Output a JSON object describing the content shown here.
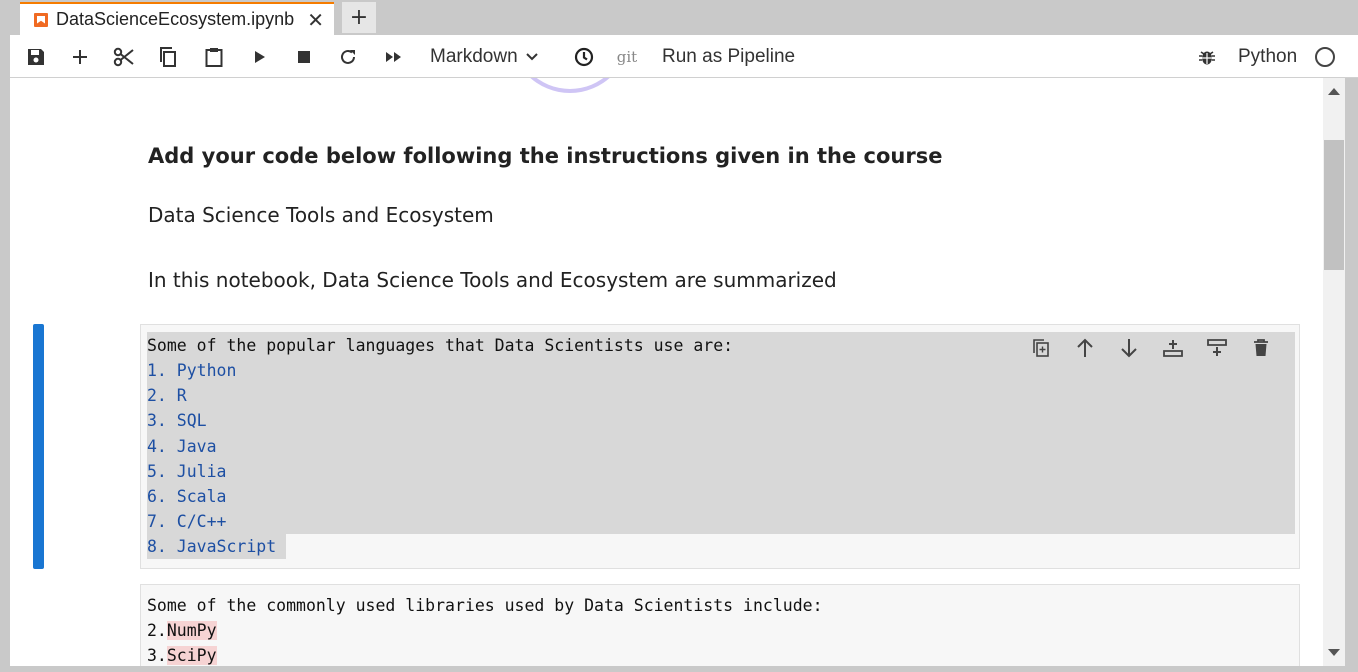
{
  "tab": {
    "title": "DataScienceEcosystem.ipynb",
    "close": "✕",
    "new": "+"
  },
  "toolbar": {
    "cell_type": "Markdown",
    "git_label": "git",
    "pipeline_label": "Run as Pipeline",
    "kernel_name": "Python"
  },
  "notebook": {
    "heading": "Add your code below following the instructions given in the course",
    "para1": "Data Science Tools and Ecosystem",
    "para2": "In this notebook, Data Science Tools and Ecosystem are summarized",
    "cell1": {
      "intro": "Some of the popular languages that Data Scientists use are:",
      "items": [
        "1. Python",
        "2. R",
        "3. SQL",
        "4. Java",
        "5. Julia",
        "6. Scala",
        "7. C/C++",
        "8. JavaScript"
      ]
    },
    "cell2": {
      "intro": "Some of the commonly used libraries used by Data Scientists include:",
      "items": [
        {
          "prefix": "2.",
          "name": "NumPy"
        },
        {
          "prefix": "3.",
          "name": "SciPy"
        }
      ]
    }
  },
  "colors": {
    "active_cell": "#1976d2",
    "tab_accent": "#f57c00",
    "list_blue": "#1d4fa3",
    "highlight": "#f6d3d3"
  }
}
